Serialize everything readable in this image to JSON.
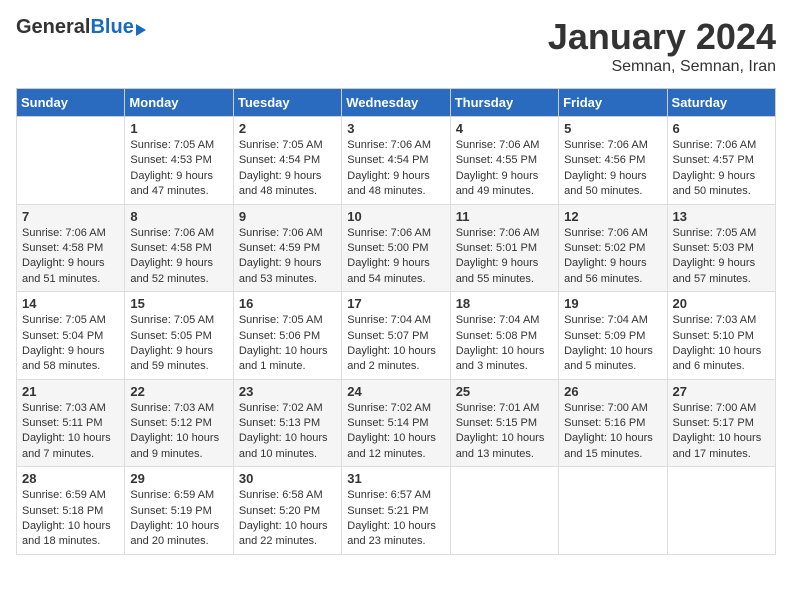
{
  "header": {
    "logo_general": "General",
    "logo_blue": "Blue",
    "month": "January 2024",
    "location": "Semnan, Semnan, Iran"
  },
  "weekdays": [
    "Sunday",
    "Monday",
    "Tuesday",
    "Wednesday",
    "Thursday",
    "Friday",
    "Saturday"
  ],
  "weeks": [
    [
      {
        "day": "",
        "info": ""
      },
      {
        "day": "1",
        "info": "Sunrise: 7:05 AM\nSunset: 4:53 PM\nDaylight: 9 hours and 47 minutes."
      },
      {
        "day": "2",
        "info": "Sunrise: 7:05 AM\nSunset: 4:54 PM\nDaylight: 9 hours and 48 minutes."
      },
      {
        "day": "3",
        "info": "Sunrise: 7:06 AM\nSunset: 4:54 PM\nDaylight: 9 hours and 48 minutes."
      },
      {
        "day": "4",
        "info": "Sunrise: 7:06 AM\nSunset: 4:55 PM\nDaylight: 9 hours and 49 minutes."
      },
      {
        "day": "5",
        "info": "Sunrise: 7:06 AM\nSunset: 4:56 PM\nDaylight: 9 hours and 50 minutes."
      },
      {
        "day": "6",
        "info": "Sunrise: 7:06 AM\nSunset: 4:57 PM\nDaylight: 9 hours and 50 minutes."
      }
    ],
    [
      {
        "day": "7",
        "info": "Sunrise: 7:06 AM\nSunset: 4:58 PM\nDaylight: 9 hours and 51 minutes."
      },
      {
        "day": "8",
        "info": "Sunrise: 7:06 AM\nSunset: 4:58 PM\nDaylight: 9 hours and 52 minutes."
      },
      {
        "day": "9",
        "info": "Sunrise: 7:06 AM\nSunset: 4:59 PM\nDaylight: 9 hours and 53 minutes."
      },
      {
        "day": "10",
        "info": "Sunrise: 7:06 AM\nSunset: 5:00 PM\nDaylight: 9 hours and 54 minutes."
      },
      {
        "day": "11",
        "info": "Sunrise: 7:06 AM\nSunset: 5:01 PM\nDaylight: 9 hours and 55 minutes."
      },
      {
        "day": "12",
        "info": "Sunrise: 7:06 AM\nSunset: 5:02 PM\nDaylight: 9 hours and 56 minutes."
      },
      {
        "day": "13",
        "info": "Sunrise: 7:05 AM\nSunset: 5:03 PM\nDaylight: 9 hours and 57 minutes."
      }
    ],
    [
      {
        "day": "14",
        "info": "Sunrise: 7:05 AM\nSunset: 5:04 PM\nDaylight: 9 hours and 58 minutes."
      },
      {
        "day": "15",
        "info": "Sunrise: 7:05 AM\nSunset: 5:05 PM\nDaylight: 9 hours and 59 minutes."
      },
      {
        "day": "16",
        "info": "Sunrise: 7:05 AM\nSunset: 5:06 PM\nDaylight: 10 hours and 1 minute."
      },
      {
        "day": "17",
        "info": "Sunrise: 7:04 AM\nSunset: 5:07 PM\nDaylight: 10 hours and 2 minutes."
      },
      {
        "day": "18",
        "info": "Sunrise: 7:04 AM\nSunset: 5:08 PM\nDaylight: 10 hours and 3 minutes."
      },
      {
        "day": "19",
        "info": "Sunrise: 7:04 AM\nSunset: 5:09 PM\nDaylight: 10 hours and 5 minutes."
      },
      {
        "day": "20",
        "info": "Sunrise: 7:03 AM\nSunset: 5:10 PM\nDaylight: 10 hours and 6 minutes."
      }
    ],
    [
      {
        "day": "21",
        "info": "Sunrise: 7:03 AM\nSunset: 5:11 PM\nDaylight: 10 hours and 7 minutes."
      },
      {
        "day": "22",
        "info": "Sunrise: 7:03 AM\nSunset: 5:12 PM\nDaylight: 10 hours and 9 minutes."
      },
      {
        "day": "23",
        "info": "Sunrise: 7:02 AM\nSunset: 5:13 PM\nDaylight: 10 hours and 10 minutes."
      },
      {
        "day": "24",
        "info": "Sunrise: 7:02 AM\nSunset: 5:14 PM\nDaylight: 10 hours and 12 minutes."
      },
      {
        "day": "25",
        "info": "Sunrise: 7:01 AM\nSunset: 5:15 PM\nDaylight: 10 hours and 13 minutes."
      },
      {
        "day": "26",
        "info": "Sunrise: 7:00 AM\nSunset: 5:16 PM\nDaylight: 10 hours and 15 minutes."
      },
      {
        "day": "27",
        "info": "Sunrise: 7:00 AM\nSunset: 5:17 PM\nDaylight: 10 hours and 17 minutes."
      }
    ],
    [
      {
        "day": "28",
        "info": "Sunrise: 6:59 AM\nSunset: 5:18 PM\nDaylight: 10 hours and 18 minutes."
      },
      {
        "day": "29",
        "info": "Sunrise: 6:59 AM\nSunset: 5:19 PM\nDaylight: 10 hours and 20 minutes."
      },
      {
        "day": "30",
        "info": "Sunrise: 6:58 AM\nSunset: 5:20 PM\nDaylight: 10 hours and 22 minutes."
      },
      {
        "day": "31",
        "info": "Sunrise: 6:57 AM\nSunset: 5:21 PM\nDaylight: 10 hours and 23 minutes."
      },
      {
        "day": "",
        "info": ""
      },
      {
        "day": "",
        "info": ""
      },
      {
        "day": "",
        "info": ""
      }
    ]
  ]
}
